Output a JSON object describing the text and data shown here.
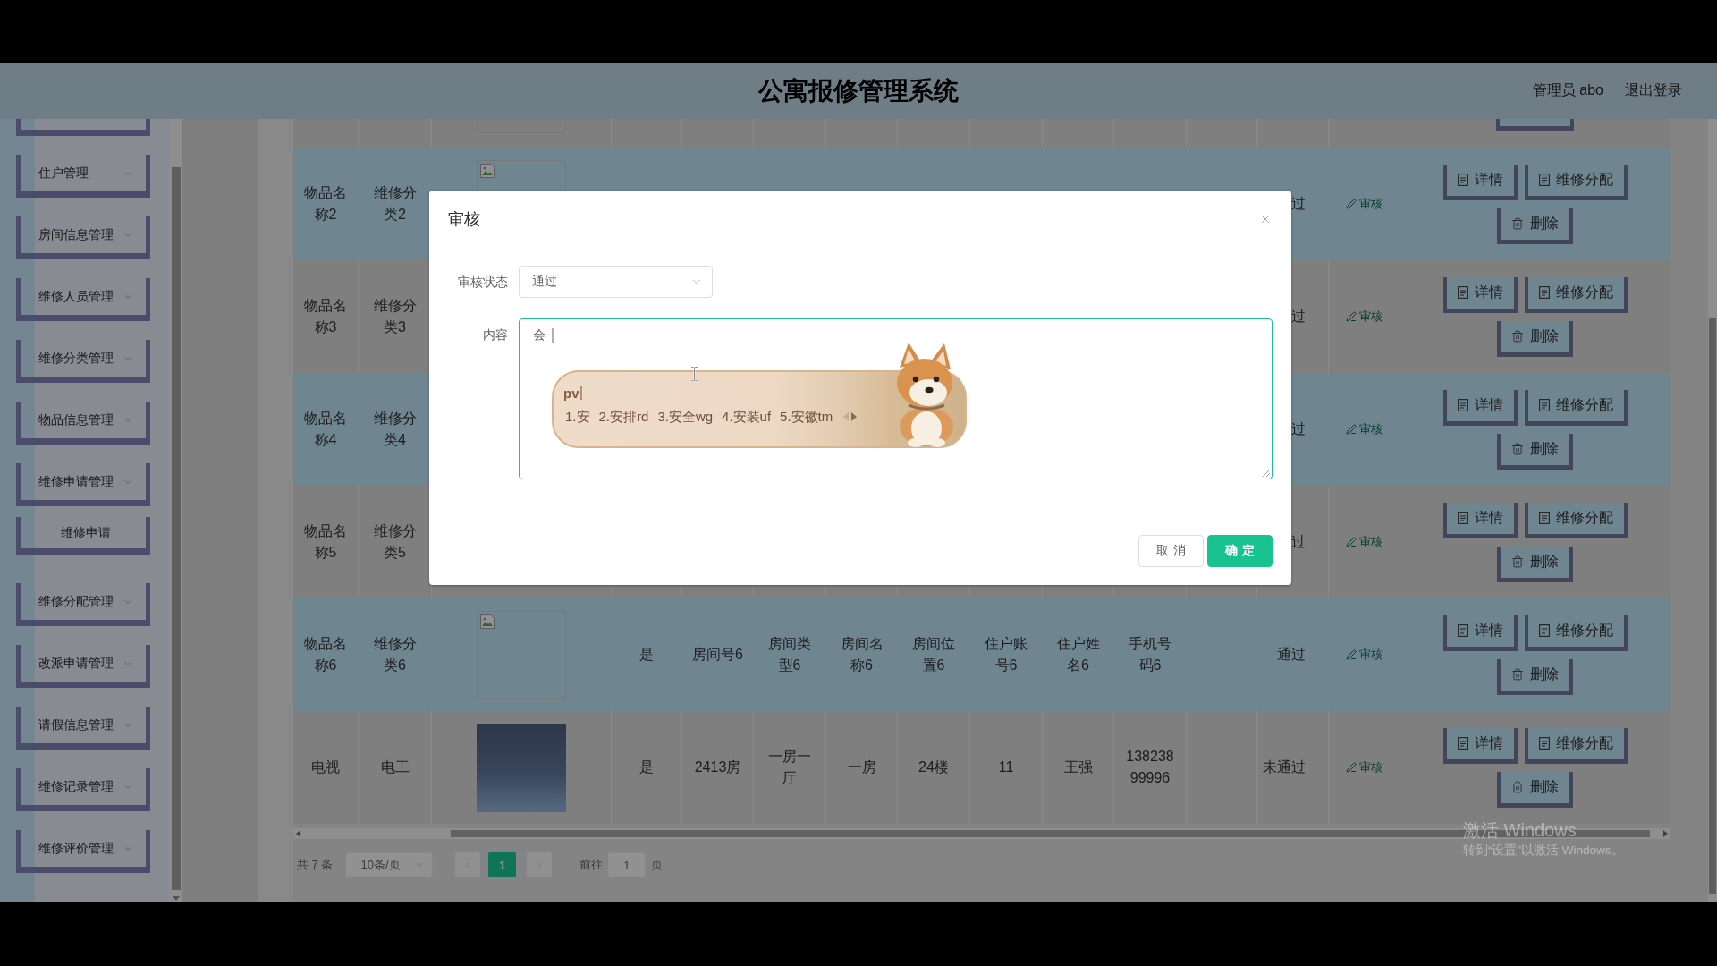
{
  "header": {
    "title": "公寓报修管理系统",
    "user": "管理员 abo",
    "logout": "退出登录"
  },
  "sidebar": {
    "items": [
      {
        "label": "住户管理"
      },
      {
        "label": "房间信息管理"
      },
      {
        "label": "维修人员管理"
      },
      {
        "label": "维修分类管理"
      },
      {
        "label": "物品信息管理"
      },
      {
        "label": "维修申请管理",
        "children": [
          {
            "label": "维修申请"
          }
        ]
      },
      {
        "label": "维修分配管理"
      },
      {
        "label": "改派申请管理"
      },
      {
        "label": "请假信息管理"
      },
      {
        "label": "维修记录管理"
      },
      {
        "label": "维修评价管理"
      }
    ]
  },
  "table": {
    "rows": [
      {
        "column_1": "物品名称2",
        "column_2": "维修分类2",
        "image": {
          "kind": "broken"
        },
        "column_13": "过",
        "review_link": "审核",
        "actions": [
          "详情",
          "维修分配",
          "删除"
        ]
      },
      {
        "column_1": "物品名称3",
        "column_2": "维修分类3",
        "column_13": "过",
        "review_link": "审核",
        "actions": [
          "详情",
          "维修分配",
          "删除"
        ]
      },
      {
        "column_1": "物品名称4",
        "column_2": "维修分类4",
        "column_13": "过",
        "review_link": "审核",
        "actions": [
          "详情",
          "维修分配",
          "删除"
        ]
      },
      {
        "column_1": "物品名称5",
        "column_2": "维修分类5",
        "column_13": "过",
        "review_link": "审核",
        "actions": [
          "详情",
          "维修分配",
          "删除"
        ]
      },
      {
        "column_1": "物品名称6",
        "column_2": "维修分类6",
        "image": {
          "kind": "broken"
        },
        "column_4": "是",
        "column_5": "房间号6",
        "column_6": "房间类型6",
        "column_7": "房间名称6",
        "column_8": "房间位置6",
        "column_9": "住户账号6",
        "column_10": "住户姓名6",
        "column_11": "手机号码6",
        "column_13": "通过",
        "review_link": "审核",
        "actions": [
          "详情",
          "维修分配",
          "删除"
        ]
      },
      {
        "column_1": "电视",
        "column_2": "电工",
        "image": {
          "kind": "photo"
        },
        "column_4": "是",
        "column_5": "2413房",
        "column_6": "一房一厅",
        "column_7": "一房",
        "column_8": "24楼",
        "column_9": "11",
        "column_10": "王强",
        "column_11": "13823899996",
        "column_13": "未通过",
        "review_link": "审核",
        "actions": [
          "详情",
          "维修分配",
          "删除"
        ]
      }
    ]
  },
  "pagination": {
    "total": "共 7 条",
    "page_size": "10条/页",
    "prev": {
      "disabled": true
    },
    "pages": [
      {
        "label": "1",
        "selected": true
      }
    ],
    "next": {
      "disabled": true
    },
    "goto_label": "前往",
    "goto_value": "1",
    "goto_suffix": "页"
  },
  "dialog": {
    "title": "审核",
    "fields": [
      {
        "kind": "select",
        "label": "审核状态",
        "value": "通过"
      },
      {
        "kind": "textarea",
        "label": "内容",
        "value": "会",
        "focused": true
      }
    ],
    "buttons": [
      {
        "kind": "default",
        "label": "取消"
      },
      {
        "kind": "primary",
        "label": "确定"
      }
    ]
  },
  "ime": {
    "composition": "pv",
    "candidates": [
      "1.安",
      "2.安排rd",
      "3.安全wg",
      "4.安装uf",
      "5.安徽tm"
    ]
  },
  "activation_notice": {
    "title": "激活 Windows",
    "text": "转到“设置”以激活 Windows。"
  }
}
